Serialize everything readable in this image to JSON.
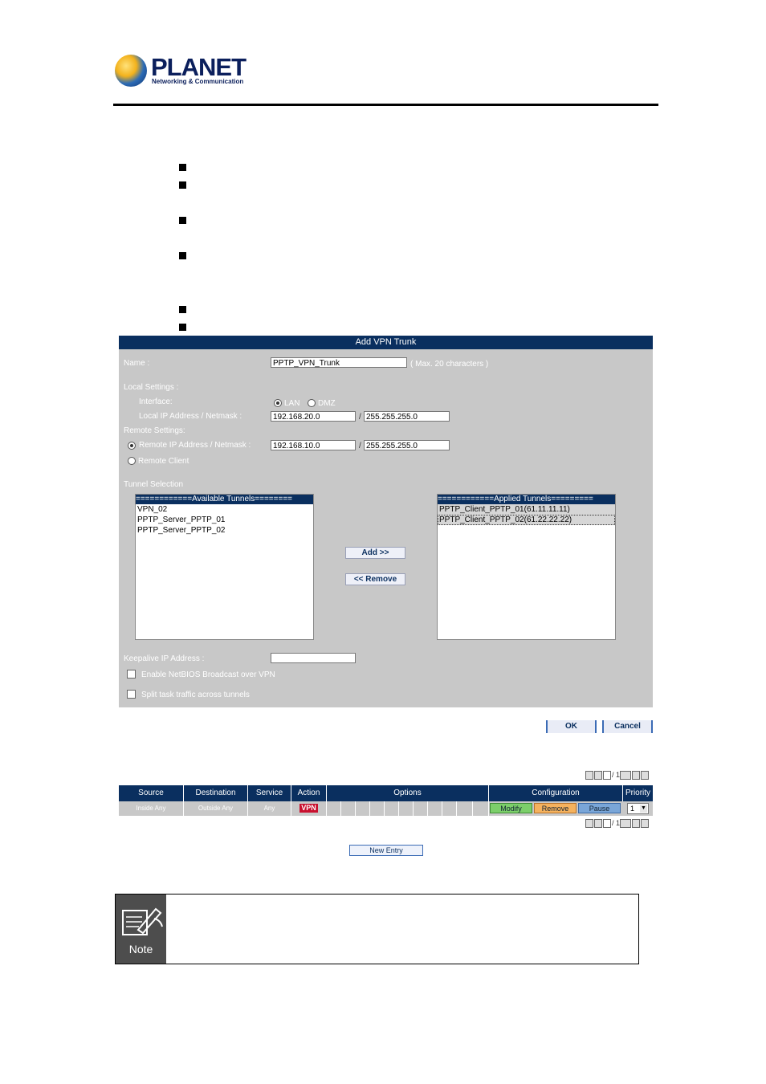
{
  "header": {
    "brand": "PLANET",
    "tagline": "Networking & Communication"
  },
  "dialog": {
    "title": "Add VPN Trunk",
    "name_label": "Name :",
    "name_value": "PPTP_VPN_Trunk",
    "name_hint": "( Max. 20 characters )",
    "local_settings_label": "Local Settings :",
    "interface_label": "Interface:",
    "interface_options": [
      "LAN",
      "DMZ"
    ],
    "interface_selected": "LAN",
    "local_ip_label": "Local IP Address / Netmask :",
    "local_ip": "192.168.20.0",
    "local_mask": "255.255.255.0",
    "remote_settings_label": "Remote Settings:",
    "remote_ip_label": "Remote IP Address / Netmask :",
    "remote_ip": "192.168.10.0",
    "remote_mask": "255.255.255.0",
    "remote_client_label": "Remote Client",
    "slash": "/",
    "tunnel_selection_label": "Tunnel Selection",
    "available_header": "============Available Tunnels========",
    "available_items": [
      "VPN_02",
      "PPTP_Server_PPTP_01",
      "PPTP_Server_PPTP_02"
    ],
    "applied_header": "============Applied Tunnels=========",
    "applied_items": [
      "PPTP_Client_PPTP_01(61.11.11.11)",
      "PPTP_Client_PPTP_02(61.22.22.22)"
    ],
    "add_button": "Add >>",
    "remove_button": "<< Remove",
    "keepalive_label": "Keepalive IP Address :",
    "keepalive_value": "",
    "netbios_label": "Enable NetBIOS Broadcast over VPN",
    "split_label": "Split task traffic across tunnels",
    "ok_button": "OK",
    "cancel_button": "Cancel"
  },
  "pager": {
    "page": "1",
    "total": "/ 1",
    "go": "Go"
  },
  "policy_table": {
    "columns": [
      "Source",
      "Destination",
      "Service",
      "Action",
      "Options",
      "Configuration",
      "Priority"
    ],
    "row": {
      "source": "Inside Any",
      "destination": "Outside Any",
      "service": "Any",
      "action": "VPN",
      "modify": "Modify",
      "remove": "Remove",
      "pause": "Pause",
      "priority": "1"
    },
    "new_entry": "New Entry"
  },
  "note": {
    "label": "Note",
    "text": ""
  },
  "colors": {
    "header_navy": "#0a2f5f",
    "panel_gray": "#c8c8c8",
    "modify_green": "#7ccf6a",
    "remove_orange": "#f5b25e",
    "pause_blue": "#7aa6d8",
    "vpn_red": "#c8102e"
  }
}
